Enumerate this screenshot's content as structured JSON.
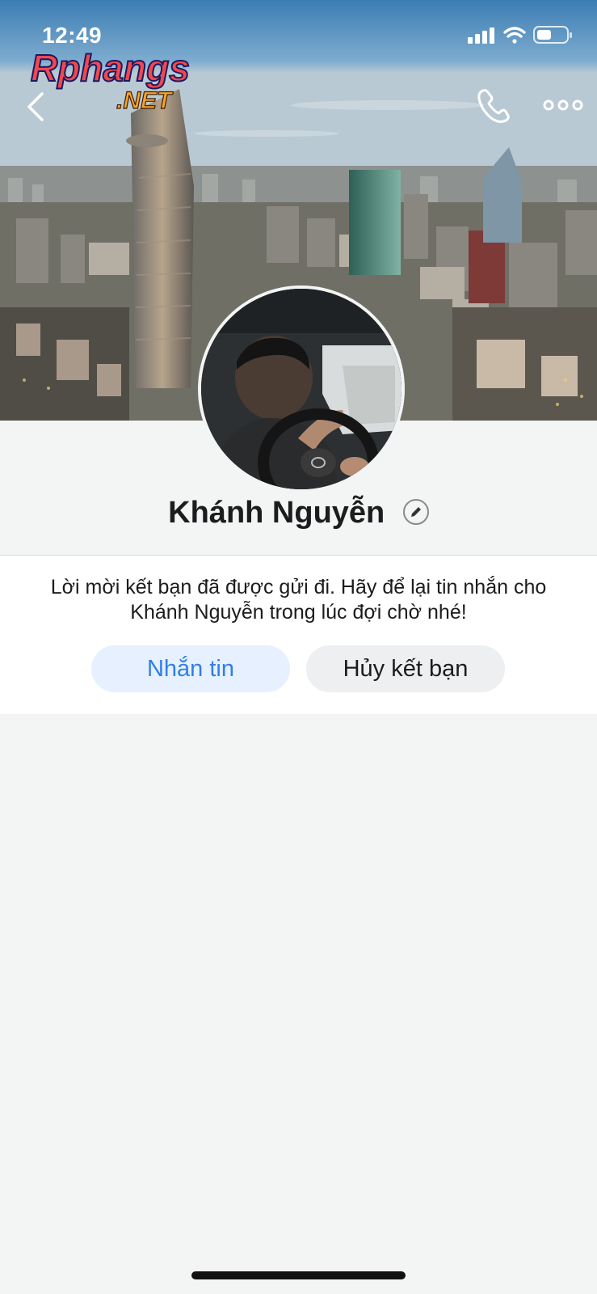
{
  "status_bar": {
    "time": "12:49",
    "signal_icon": "cellular-signal-icon",
    "wifi_icon": "wifi-icon",
    "battery_icon": "battery-icon"
  },
  "watermark": {
    "text_main": "Rphangs",
    "text_sub": ".NET"
  },
  "nav": {
    "back_icon": "chevron-left-icon",
    "call_icon": "phone-icon",
    "more_icon": "more-dots-icon"
  },
  "profile": {
    "name": "Khánh Nguyễn",
    "edit_icon": "pencil-icon"
  },
  "friend_request": {
    "message": "Lời mời kết bạn đã được gửi đi. Hãy để lại tin nhắn cho Khánh Nguyễn trong lúc đợi chờ nhé!",
    "message_button": "Nhắn tin",
    "cancel_button": "Hủy kết bạn"
  },
  "colors": {
    "accent": "#2f7fe8",
    "message_button_bg": "#e7f0fe",
    "cancel_button_bg": "#eeeff1",
    "page_bg": "#f3f4f4"
  }
}
